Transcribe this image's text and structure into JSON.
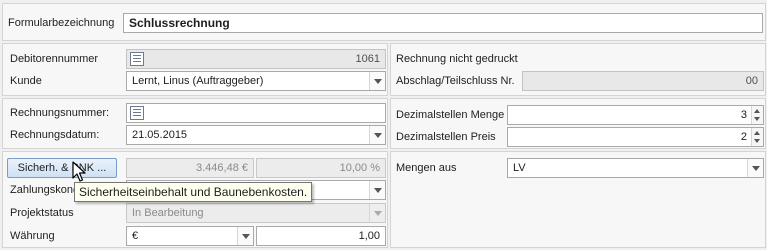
{
  "form": {
    "label": "Formularbezeichnung",
    "value": "Schlussrechnung"
  },
  "debtor": {
    "number_label": "Debitorennummer",
    "number_value": "1061",
    "customer_label": "Kunde",
    "customer_value": "Lernt, Linus (Auftraggeber)",
    "print_status": "Rechnung nicht gedruckt",
    "partial_label": "Abschlag/Teilschluss Nr.",
    "partial_value": "00"
  },
  "invoice": {
    "number_label": "Rechnungsnummer:",
    "number_value": "",
    "date_label": "Rechnungsdatum:",
    "date_value": "21.05.2015",
    "decimals_qty_label": "Dezimalstellen Menge",
    "decimals_qty_value": "3",
    "decimals_price_label": "Dezimalstellen Preis",
    "decimals_price_value": "2"
  },
  "payment": {
    "security_button": "Sicherh. & BNK ...",
    "security_amount": "3.446,48 €",
    "security_percent": "10,00 %",
    "conditions_label": "Zahlungskond",
    "conditions_value": "",
    "project_status_label": "Projektstatus",
    "project_status_value": "In Bearbeitung",
    "currency_label": "Währung",
    "currency_value": "€",
    "exchange_rate": "1,00",
    "quantities_label": "Mengen aus",
    "quantities_value": "LV"
  },
  "tooltip": {
    "text": "Sicherheitseinbehalt und Baunebenkosten."
  }
}
